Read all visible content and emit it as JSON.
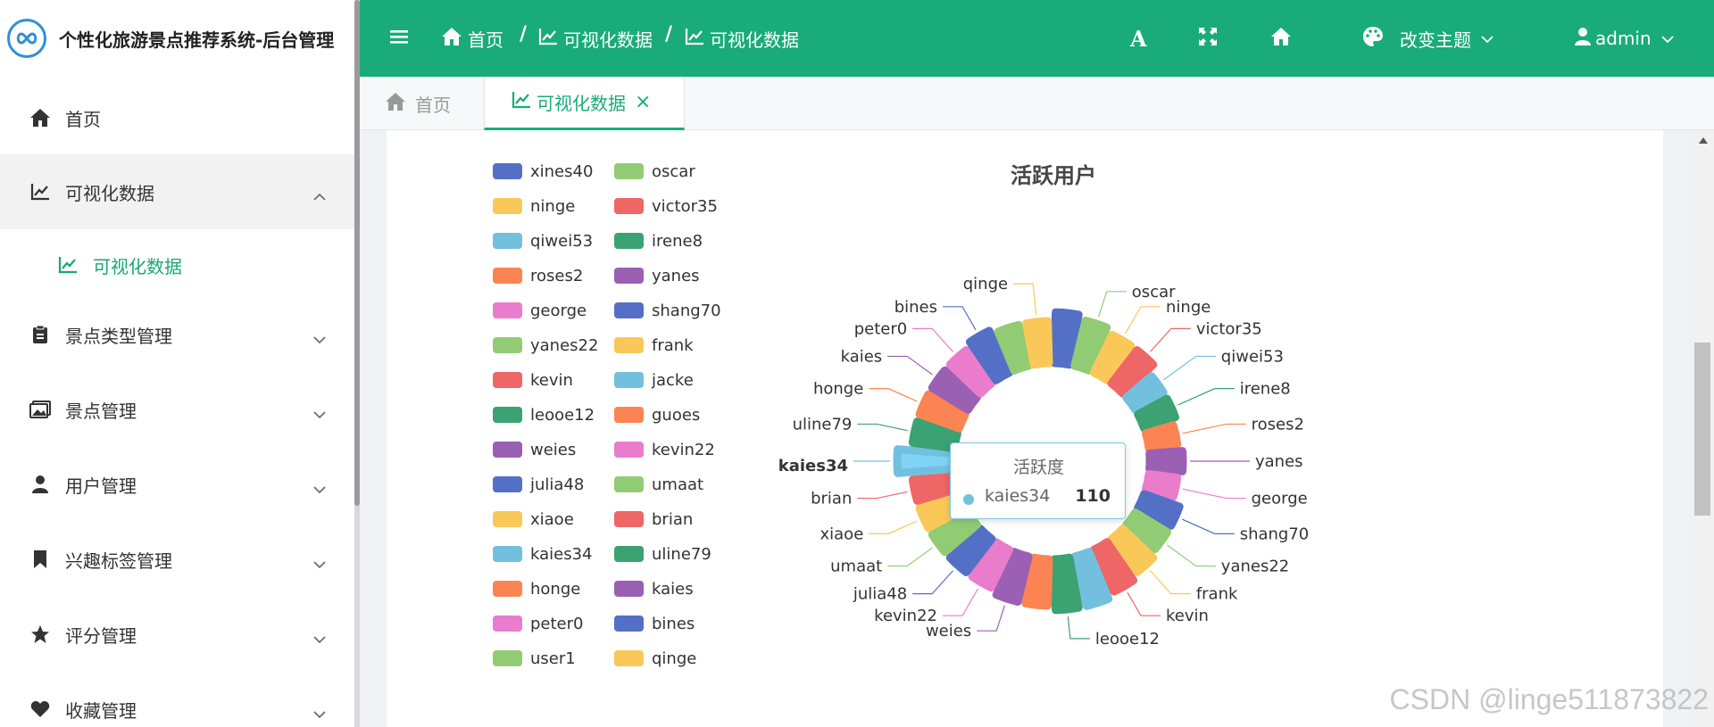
{
  "app": {
    "title": "个性化旅游景点推荐系统-后台管理"
  },
  "sidebar": {
    "items": [
      {
        "label": "首页",
        "icon": "home-icon"
      },
      {
        "label": "可视化数据",
        "icon": "line-chart-icon",
        "expanded": true
      },
      {
        "label": "可视化数据",
        "icon": "line-chart-icon",
        "submenu": true,
        "active": true
      },
      {
        "label": "景点类型管理",
        "icon": "clipboard-icon"
      },
      {
        "label": "景点管理",
        "icon": "image-icon"
      },
      {
        "label": "用户管理",
        "icon": "user-icon"
      },
      {
        "label": "兴趣标签管理",
        "icon": "bookmark-icon"
      },
      {
        "label": "评分管理",
        "icon": "star-icon"
      },
      {
        "label": "收藏管理",
        "icon": "heart-icon"
      }
    ]
  },
  "header": {
    "breadcrumb": [
      "首页",
      "可视化数据",
      "可视化数据"
    ],
    "separator": "/",
    "theme_label": "改变主题",
    "user_label": "admin",
    "font_icon_text": "A"
  },
  "tabs": [
    {
      "label": "首页",
      "active": false
    },
    {
      "label": "可视化数据",
      "active": true,
      "close": "×"
    }
  ],
  "chart_data": {
    "type": "pie",
    "subtype": "nightingale-rose",
    "title": "活跃用户",
    "legend_position": "left",
    "slices": [
      {
        "name": "xines40",
        "value": 110,
        "color": "#5470c6"
      },
      {
        "name": "oscar",
        "value": 105,
        "color": "#91cc75"
      },
      {
        "name": "ninge",
        "value": 100,
        "color": "#fac858"
      },
      {
        "name": "victor35",
        "value": 100,
        "color": "#ee6666"
      },
      {
        "name": "qiwei53",
        "value": 90,
        "color": "#73c0de"
      },
      {
        "name": "irene8",
        "value": 90,
        "color": "#3ba272"
      },
      {
        "name": "roses2",
        "value": 85,
        "color": "#fc8452"
      },
      {
        "name": "yanes",
        "value": 90,
        "color": "#9a60b4"
      },
      {
        "name": "george",
        "value": 85,
        "color": "#ea7ccc"
      },
      {
        "name": "shang70",
        "value": 95,
        "color": "#5470c6"
      },
      {
        "name": "yanes22",
        "value": 95,
        "color": "#91cc75"
      },
      {
        "name": "frank",
        "value": 100,
        "color": "#fac858"
      },
      {
        "name": "kevin",
        "value": 105,
        "color": "#ee6666"
      },
      {
        "name": "jacke",
        "value": 110,
        "color": "#73c0de"
      },
      {
        "name": "leooe12",
        "value": 110,
        "color": "#3ba272"
      },
      {
        "name": "guoes",
        "value": 105,
        "color": "#fc8452"
      },
      {
        "name": "weies",
        "value": 105,
        "color": "#9a60b4"
      },
      {
        "name": "kevin22",
        "value": 100,
        "color": "#ea7ccc"
      },
      {
        "name": "julia48",
        "value": 100,
        "color": "#5470c6"
      },
      {
        "name": "umaat",
        "value": 100,
        "color": "#91cc75"
      },
      {
        "name": "xiaoe",
        "value": 100,
        "color": "#fac858"
      },
      {
        "name": "brian",
        "value": 100,
        "color": "#ee6666"
      },
      {
        "name": "kaies34",
        "value": 110,
        "color": "#73c0de"
      },
      {
        "name": "uline79",
        "value": 100,
        "color": "#3ba272"
      },
      {
        "name": "honge",
        "value": 100,
        "color": "#fc8452"
      },
      {
        "name": "kaies",
        "value": 100,
        "color": "#9a60b4"
      },
      {
        "name": "peter0",
        "value": 100,
        "color": "#ea7ccc"
      },
      {
        "name": "bines",
        "value": 105,
        "color": "#5470c6"
      },
      {
        "name": "user1",
        "value": 100,
        "color": "#91cc75"
      },
      {
        "name": "qinge",
        "value": 100,
        "color": "#fac858"
      }
    ],
    "highlighted": "kaies34",
    "tooltip": {
      "title": "活跃度",
      "name": "kaies34",
      "value": "110"
    },
    "hidden_labels": [
      "xines40",
      "jacke",
      "guoes",
      "user1"
    ]
  },
  "watermark": "CSDN @linge511873822"
}
